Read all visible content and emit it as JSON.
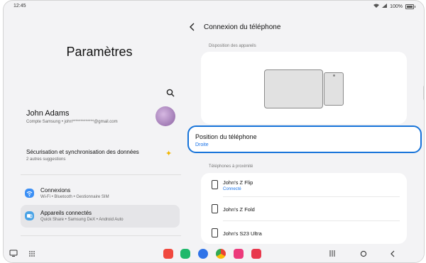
{
  "status": {
    "time": "12:45",
    "battery": "100%"
  },
  "left": {
    "title": "Paramètres",
    "profile": {
      "name": "John Adams",
      "account": "Compte Samsung • john*************@gmail.com"
    },
    "security": {
      "title": "Sécurisation et synchronisation des données",
      "subtitle": "2 autres suggestions"
    },
    "menu": [
      {
        "title": "Connexions",
        "subtitle": "Wi-Fi • Bluetooth • Gestionnaire SIM",
        "icon": "wifi-icon",
        "color": "#3b8ff5"
      },
      {
        "title": "Appareils connectés",
        "subtitle": "Quick Share • Samsung DeX • Android Auto",
        "icon": "connected-devices-icon",
        "color": "#4aa3e6"
      }
    ]
  },
  "right": {
    "title": "Connexion du téléphone",
    "layout_label": "Disposition des appareils",
    "position": {
      "title": "Position du téléphone",
      "value": "Droite"
    },
    "nearby_label": "Téléphones à proximité",
    "phones": [
      {
        "name": "John's Z Flip",
        "status": "Connecté"
      },
      {
        "name": "John's Z Fold",
        "status": ""
      },
      {
        "name": "John's S23 Ultra",
        "status": ""
      }
    ]
  },
  "colors": {
    "accent": "#1673d9",
    "link": "#1a73e8"
  }
}
